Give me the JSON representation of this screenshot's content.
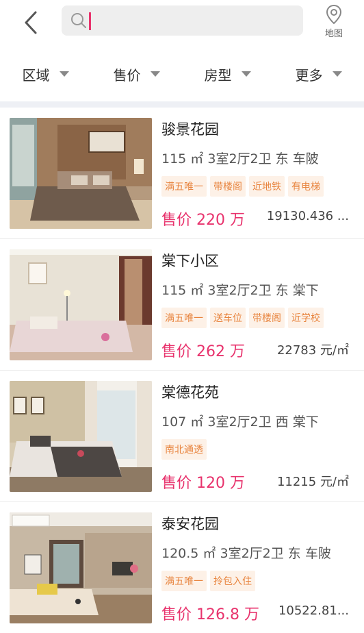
{
  "search": {
    "placeholder": ""
  },
  "map_label": "地图",
  "filters": [
    "区域",
    "售价",
    "房型",
    "更多"
  ],
  "listings": [
    {
      "name": "骏景花园",
      "area": "115 ㎡",
      "layout": "3室2厅2卫",
      "orientation": "东",
      "district": "车陂",
      "tags": [
        "满五唯一",
        "带楼阁",
        "近地铁",
        "有电梯"
      ],
      "price": "售价 220 万",
      "unit_price": "19130.436 ..."
    },
    {
      "name": "棠下小区",
      "area": "115 ㎡",
      "layout": "3室2厅2卫",
      "orientation": "东",
      "district": "棠下",
      "tags": [
        "满五唯一",
        "送车位",
        "带楼阁",
        "近学校"
      ],
      "price": "售价 262 万",
      "unit_price": "22783 元/㎡"
    },
    {
      "name": "棠德花苑",
      "area": "107 ㎡",
      "layout": "3室2厅2卫",
      "orientation": "西",
      "district": "棠下",
      "tags": [
        "南北通透"
      ],
      "price": "售价 120 万",
      "unit_price": "11215 元/㎡"
    },
    {
      "name": "泰安花园",
      "area": "120.5 ㎡",
      "layout": "3室2厅2卫",
      "orientation": "东",
      "district": "车陂",
      "tags": [
        "满五唯一",
        "拎包入住"
      ],
      "price": "售价 126.8 万",
      "unit_price": "10522.81..."
    }
  ]
}
